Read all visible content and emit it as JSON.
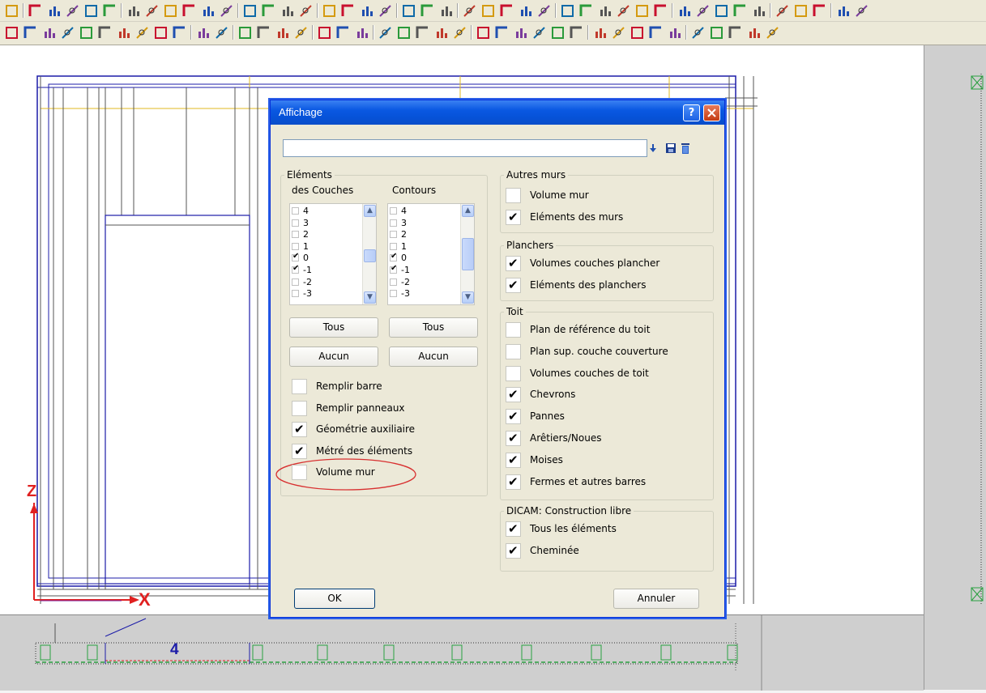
{
  "dialog": {
    "title": "Affichage",
    "help_label": "?",
    "preset_value": ""
  },
  "elements": {
    "legend": "Eléments",
    "col1_header": "des Couches",
    "col2_header": "Contours",
    "layers": [
      "4",
      "3",
      "2",
      "1",
      "0",
      "-1",
      "-2",
      "-3"
    ],
    "couches_checked": [
      false,
      false,
      false,
      false,
      true,
      true,
      false,
      false
    ],
    "contours_checked": [
      false,
      false,
      false,
      false,
      true,
      true,
      false,
      false
    ],
    "tous_label": "Tous",
    "aucun_label": "Aucun",
    "options": [
      {
        "label": "Remplir barre",
        "checked": false
      },
      {
        "label": "Remplir panneaux",
        "checked": false
      },
      {
        "label": "Géométrie auxiliaire",
        "checked": true
      },
      {
        "label": "Métré des éléments",
        "checked": true
      },
      {
        "label": "Volume mur",
        "checked": false
      }
    ]
  },
  "autres_murs": {
    "legend": "Autres murs",
    "items": [
      {
        "label": "Volume mur",
        "checked": false
      },
      {
        "label": "Eléments des murs",
        "checked": true
      }
    ]
  },
  "planchers": {
    "legend": "Planchers",
    "items": [
      {
        "label": "Volumes couches plancher",
        "checked": true
      },
      {
        "label": "Eléments des planchers",
        "checked": true
      }
    ]
  },
  "toit": {
    "legend": "Toit",
    "items": [
      {
        "label": "Plan de référence du toit",
        "checked": false
      },
      {
        "label": "Plan sup. couche couverture",
        "checked": false
      },
      {
        "label": "Volumes couches de toit",
        "checked": false
      },
      {
        "label": "Chevrons",
        "checked": true
      },
      {
        "label": "Pannes",
        "checked": true
      },
      {
        "label": "Arêtiers/Noues",
        "checked": true
      },
      {
        "label": "Moises",
        "checked": true
      },
      {
        "label": "Fermes et autres barres",
        "checked": true
      }
    ]
  },
  "dicam": {
    "legend": "DICAM: Construction libre",
    "items": [
      {
        "label": "Tous les éléments",
        "checked": true
      },
      {
        "label": "Cheminée",
        "checked": true
      }
    ]
  },
  "buttons": {
    "ok": "OK",
    "cancel": "Annuler"
  },
  "drawing": {
    "axis_z": "Z",
    "axis_x": "X",
    "dimension_label": "4"
  },
  "colors": {
    "title_blue": "#0a58e2",
    "dialog_bg": "#ece9d8",
    "axis_red": "#e02020",
    "highlight_ellipse": "#d83030",
    "wall_blue": "#1c1ca8",
    "beam_yellow": "#e0b820",
    "module_green": "#2aa040"
  }
}
